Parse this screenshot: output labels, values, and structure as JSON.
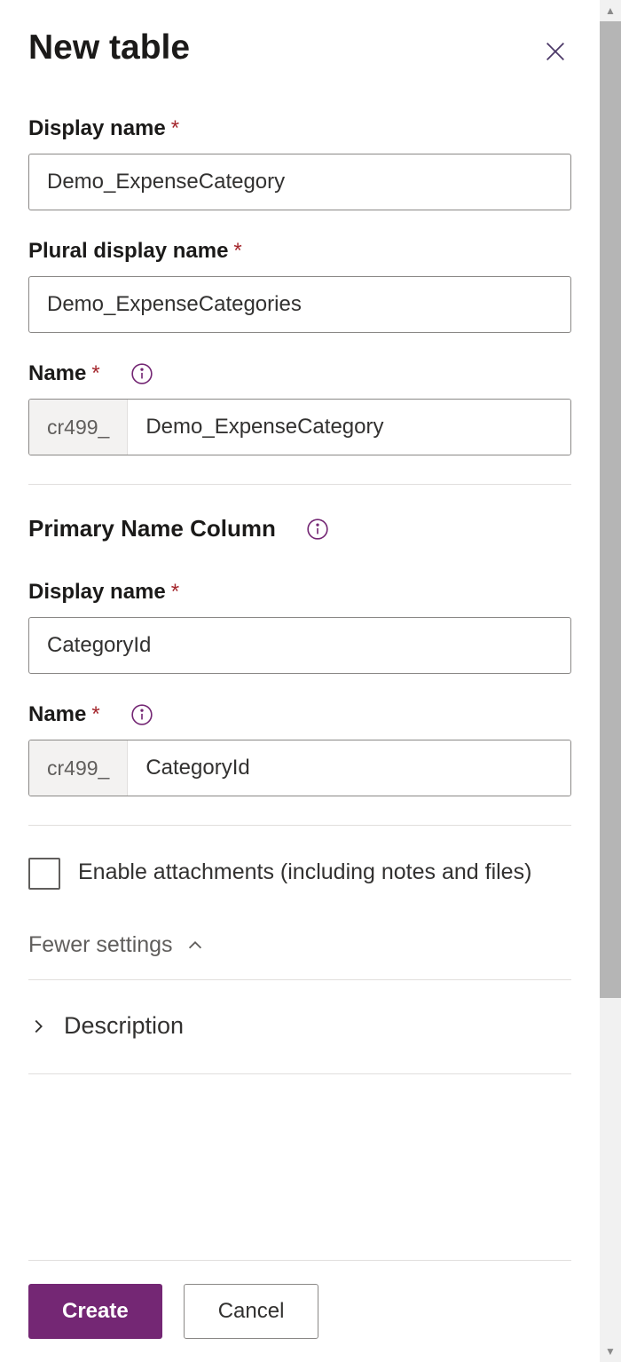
{
  "header": {
    "title": "New table"
  },
  "fields": {
    "display_name": {
      "label": "Display name",
      "value": "Demo_ExpenseCategory"
    },
    "plural_display_name": {
      "label": "Plural display name",
      "value": "Demo_ExpenseCategories"
    },
    "name": {
      "label": "Name",
      "prefix": "cr499_",
      "value": "Demo_ExpenseCategory"
    }
  },
  "primary_name_column": {
    "section_title": "Primary Name Column",
    "display_name": {
      "label": "Display name",
      "value": "CategoryId"
    },
    "name": {
      "label": "Name",
      "prefix": "cr499_",
      "value": "CategoryId"
    }
  },
  "options": {
    "enable_attachments_label": "Enable attachments (including notes and files)"
  },
  "toggles": {
    "fewer_settings_label": "Fewer settings",
    "description_label": "Description"
  },
  "footer": {
    "create_label": "Create",
    "cancel_label": "Cancel"
  }
}
